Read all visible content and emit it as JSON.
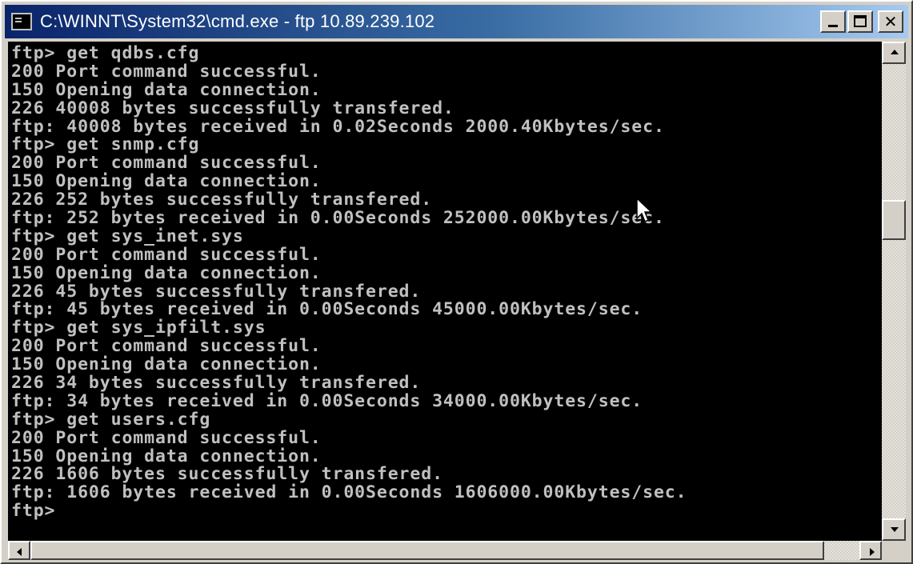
{
  "window": {
    "title": "C:\\WINNT\\System32\\cmd.exe - ftp 10.89.239.102",
    "icon": "console-app-icon",
    "controls": {
      "minimize_icon": "minimize-icon",
      "maximize_icon": "maximize-icon",
      "close_glyph": "✕"
    },
    "titlebar_colors": [
      "#0a246a",
      "#a6caf0"
    ]
  },
  "console": {
    "background": "#000000",
    "foreground": "#c0c0c0",
    "lines": [
      "ftp> get qdbs.cfg",
      "200 Port command successful.",
      "150 Opening data connection.",
      "226 40008 bytes successfully transfered.",
      "ftp: 40008 bytes received in 0.02Seconds 2000.40Kbytes/sec.",
      "ftp> get snmp.cfg",
      "200 Port command successful.",
      "150 Opening data connection.",
      "226 252 bytes successfully transfered.",
      "ftp: 252 bytes received in 0.00Seconds 252000.00Kbytes/sec.",
      "ftp> get sys_inet.sys",
      "200 Port command successful.",
      "150 Opening data connection.",
      "226 45 bytes successfully transfered.",
      "ftp: 45 bytes received in 0.00Seconds 45000.00Kbytes/sec.",
      "ftp> get sys_ipfilt.sys",
      "200 Port command successful.",
      "150 Opening data connection.",
      "226 34 bytes successfully transfered.",
      "ftp: 34 bytes received in 0.00Seconds 34000.00Kbytes/sec.",
      "ftp> get users.cfg",
      "200 Port command successful.",
      "150 Opening data connection.",
      "226 1606 bytes successfully transfered.",
      "ftp: 1606 bytes received in 0.00Seconds 1606000.00Kbytes/sec.",
      "ftp>"
    ]
  },
  "scrollbars": {
    "vertical_icons": [
      "scroll-up-arrow-icon",
      "scroll-down-arrow-icon"
    ],
    "horizontal_icons": [
      "scroll-left-arrow-icon",
      "scroll-right-arrow-icon"
    ]
  }
}
